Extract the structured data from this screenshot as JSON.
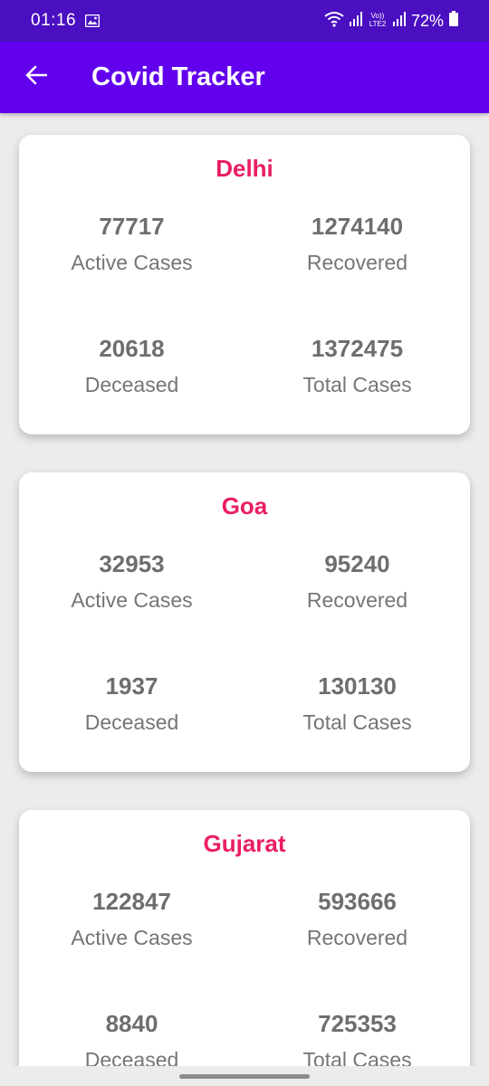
{
  "status_bar": {
    "time": "01:16",
    "network_label": "Vo)) LTE2",
    "battery": "72%"
  },
  "app_bar": {
    "title": "Covid Tracker"
  },
  "colors": {
    "status_bar": "#4a0fc0",
    "app_bar": "#6200ee",
    "state_title": "#e91e63",
    "stat_text": "#6e6e6e",
    "background": "#ececec"
  },
  "states": [
    {
      "name": "Delhi",
      "active": "77717",
      "active_label": "Active Cases",
      "recovered": "1274140",
      "recovered_label": "Recovered",
      "deceased": "20618",
      "deceased_label": "Deceased",
      "total": "1372475",
      "total_label": "Total Cases"
    },
    {
      "name": "Goa",
      "active": "32953",
      "active_label": "Active Cases",
      "recovered": "95240",
      "recovered_label": "Recovered",
      "deceased": "1937",
      "deceased_label": "Deceased",
      "total": "130130",
      "total_label": "Total Cases"
    },
    {
      "name": "Gujarat",
      "active": "122847",
      "active_label": "Active Cases",
      "recovered": "593666",
      "recovered_label": "Recovered",
      "deceased": "8840",
      "deceased_label": "Deceased",
      "total": "725353",
      "total_label": "Total Cases"
    }
  ]
}
